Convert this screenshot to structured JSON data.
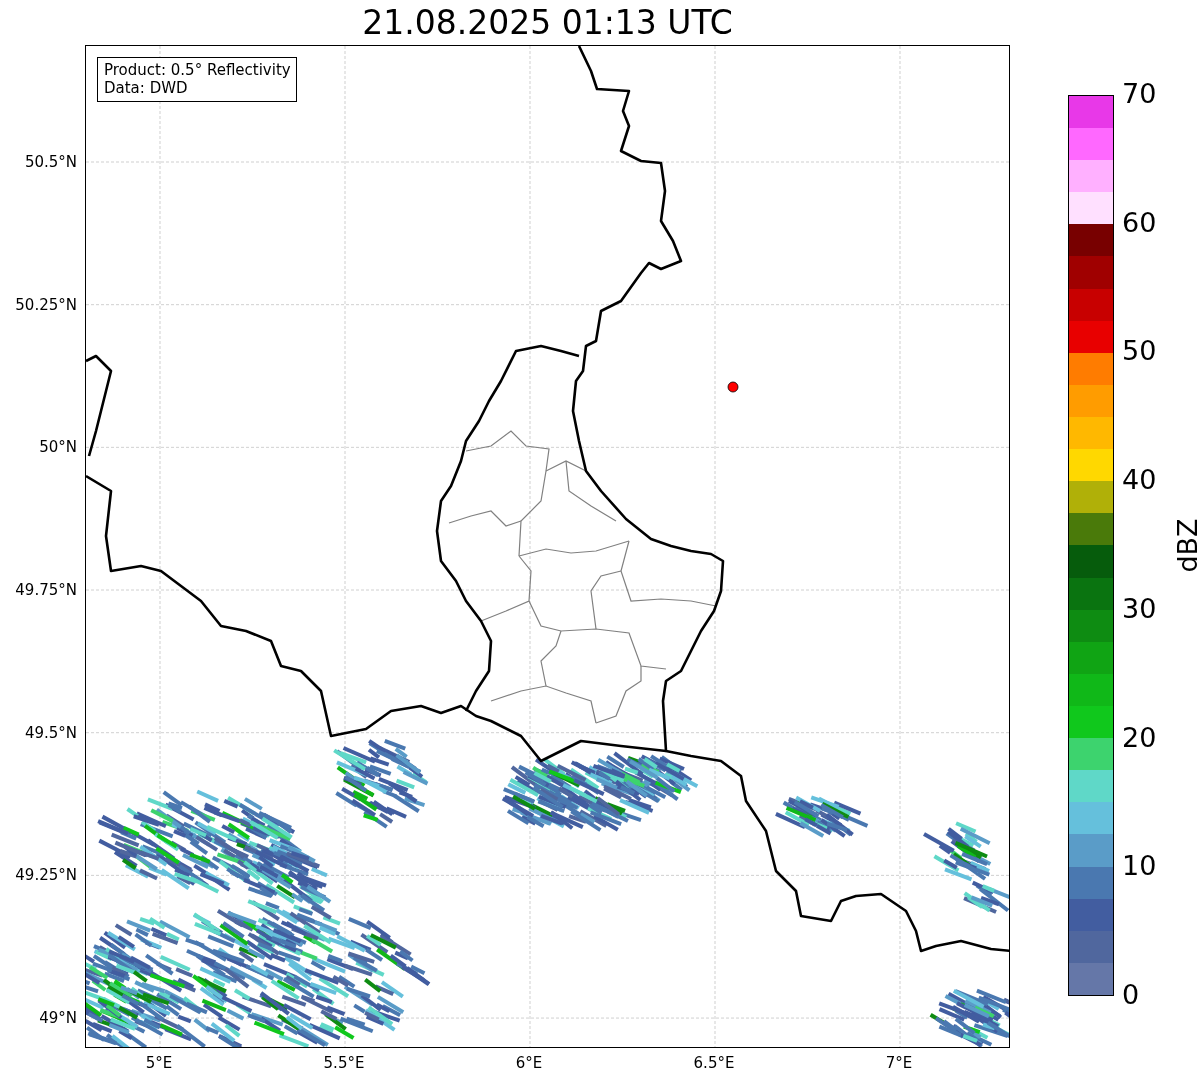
{
  "title": "21.08.2025 01:13 UTC",
  "legend": [
    "Product: 0.5° Reflectivity",
    "Data: DWD"
  ],
  "lat_ticks": [
    "50.5°N",
    "50.25°N",
    "50°N",
    "49.75°N",
    "49.5°N",
    "49.25°N",
    "49°N"
  ],
  "lon_ticks": [
    "5°E",
    "5.5°E",
    "6°E",
    "6.5°E",
    "7°E"
  ],
  "colorbar": {
    "label": "dBZ",
    "ticks": [
      "70",
      "60",
      "50",
      "40",
      "30",
      "20",
      "10",
      "0"
    ],
    "segments": [
      {
        "color": "#6577a8"
      },
      {
        "color": "#50679e"
      },
      {
        "color": "#425da0"
      },
      {
        "color": "#4a78b0"
      },
      {
        "color": "#5a9cc8"
      },
      {
        "color": "#65c0dc"
      },
      {
        "color": "#5fd8c8"
      },
      {
        "color": "#3dd36e"
      },
      {
        "color": "#10c81c"
      },
      {
        "color": "#10b818"
      },
      {
        "color": "#10a414"
      },
      {
        "color": "#0e8c12"
      },
      {
        "color": "#0a7410"
      },
      {
        "color": "#065c0c"
      },
      {
        "color": "#4a7a0a"
      },
      {
        "color": "#b0b008"
      },
      {
        "color": "#ffd800"
      },
      {
        "color": "#ffb800"
      },
      {
        "color": "#ff9c00"
      },
      {
        "color": "#ff7c00"
      },
      {
        "color": "#e80000"
      },
      {
        "color": "#c80000"
      },
      {
        "color": "#a00000"
      },
      {
        "color": "#780000"
      },
      {
        "color": "#ffe0ff"
      },
      {
        "color": "#ffb0ff"
      },
      {
        "color": "#ff68ff"
      },
      {
        "color": "#e838e8"
      }
    ]
  }
}
